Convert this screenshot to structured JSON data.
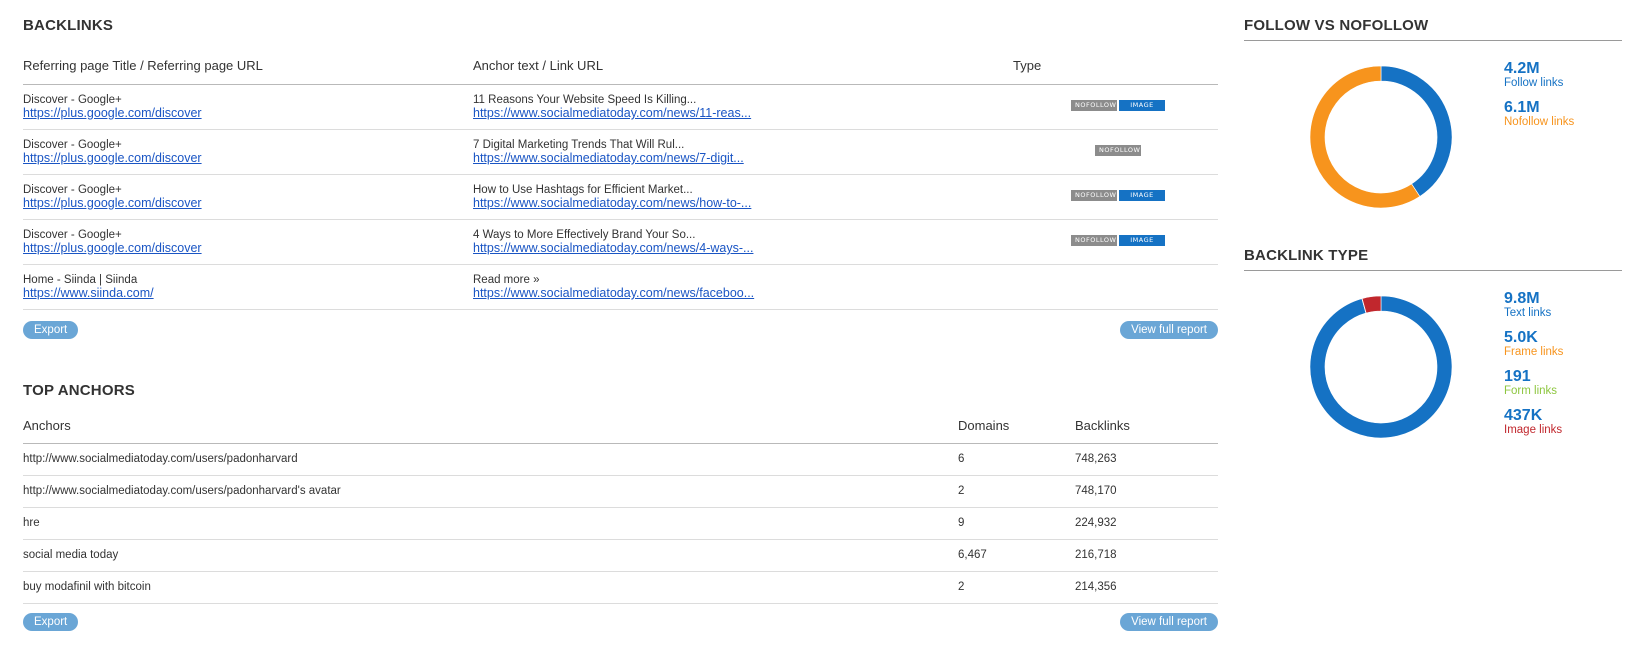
{
  "backlinks": {
    "title": "BACKLINKS",
    "headers": {
      "referring": "Referring page Title / Referring page URL",
      "anchor": "Anchor text / Link URL",
      "type": "Type"
    },
    "rows": [
      {
        "title": "Discover - Google+",
        "url": "https://plus.google.com/discover",
        "anchor": "11 Reasons Your Website Speed Is Killing...",
        "link": "https://www.socialmediatoday.com/news/11-reas...",
        "badges": [
          "nofollow",
          "image"
        ]
      },
      {
        "title": "Discover - Google+",
        "url": "https://plus.google.com/discover",
        "anchor": "7 Digital Marketing Trends That Will Rul...",
        "link": "https://www.socialmediatoday.com/news/7-digit...",
        "badges": [
          "nofollow"
        ]
      },
      {
        "title": "Discover - Google+",
        "url": "https://plus.google.com/discover",
        "anchor": "How to Use Hashtags for Efficient Market...",
        "link": "https://www.socialmediatoday.com/news/how-to-...",
        "badges": [
          "nofollow",
          "image"
        ]
      },
      {
        "title": "Discover - Google+",
        "url": "https://plus.google.com/discover",
        "anchor": "4 Ways to More Effectively Brand Your So...",
        "link": "https://www.socialmediatoday.com/news/4-ways-...",
        "badges": [
          "nofollow",
          "image"
        ]
      },
      {
        "title": "Home - Siinda | Siinda",
        "url": "https://www.siinda.com/",
        "anchor": "Read more »",
        "link": "https://www.socialmediatoday.com/news/faceboo...",
        "badges": []
      }
    ],
    "export_label": "Export",
    "report_label": "View full report"
  },
  "badge_labels": {
    "nofollow": "NOFOLLOW",
    "image": "IMAGE"
  },
  "anchors": {
    "title": "TOP ANCHORS",
    "headers": {
      "anchors": "Anchors",
      "domains": "Domains",
      "backlinks": "Backlinks"
    },
    "rows": [
      {
        "anchor": "http://www.socialmediatoday.com/users/padonharvard",
        "domains": "6",
        "backlinks": "748,263"
      },
      {
        "anchor": "http://www.socialmediatoday.com/users/padonharvard's avatar",
        "domains": "2",
        "backlinks": "748,170"
      },
      {
        "anchor": "hre",
        "domains": "9",
        "backlinks": "224,932"
      },
      {
        "anchor": "social media today",
        "domains": "6,467",
        "backlinks": "216,718"
      },
      {
        "anchor": "buy modafinil with bitcoin",
        "domains": "2",
        "backlinks": "214,356"
      }
    ],
    "export_label": "Export",
    "report_label": "View full report"
  },
  "follow": {
    "title": "FOLLOW VS NOFOLLOW",
    "items": [
      {
        "value": "4.2M",
        "label": "Follow links",
        "color": "#1572c4",
        "share": 0.408
      },
      {
        "value": "6.1M",
        "label": "Nofollow links",
        "color": "#f7941d",
        "share": 0.592
      }
    ]
  },
  "type": {
    "title": "BACKLINK TYPE",
    "items": [
      {
        "value": "9.8M",
        "label": "Text links",
        "color": "#1572c4",
        "share": 0.9566
      },
      {
        "value": "5.0K",
        "label": "Frame links",
        "color": "#f7941d",
        "share": 0.0005
      },
      {
        "value": "191",
        "label": "Form links",
        "color": "#8dc63f",
        "share": 0.0002
      },
      {
        "value": "437K",
        "label": "Image links",
        "color": "#c1272d",
        "share": 0.0427
      }
    ]
  }
}
